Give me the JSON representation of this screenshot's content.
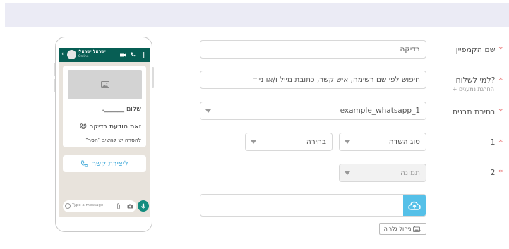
{
  "form": {
    "campaign_name": {
      "label": "שם הקמפיין",
      "value": "בדיקה"
    },
    "recipients": {
      "label": "למי לשלוח?",
      "sublabel": "+ החרגת נמענים",
      "placeholder": "חיפוש לפי שם רשימה, איש קשר, כתובת מייל ו/או נייד"
    },
    "template": {
      "label": "בחירת תבנית",
      "value": "example_whatsapp_1"
    },
    "variable_1": {
      "label": "1",
      "field_type": "סוג השדה",
      "choice": "בחירה"
    },
    "variable_2": {
      "label": "2",
      "field_type": "תמונה"
    },
    "gallery_button": "ניהול גלריה"
  },
  "preview": {
    "contact_name": "ישראל ישראלי",
    "contact_status": "Online",
    "greeting": "שלום ______,",
    "message_line": "זאת הודעת בדיקה",
    "message_emoji": "😆",
    "unsubscribe_line": "להסרה יש להשיב \"הסר\"",
    "cta_label": "ליצירת קשר",
    "input_placeholder": "Type a message"
  },
  "icons": {
    "upload": "cloud-upload-icon",
    "gallery": "gallery-icon",
    "image_placeholder": "image-icon",
    "phone_cta": "phone-icon"
  },
  "colors": {
    "required_star": "#e25858",
    "upload_button": "#55c0e8",
    "whatsapp_header": "#075e54",
    "whatsapp_chat_bg": "#e8e3dc",
    "cta_text": "#3da7d8"
  }
}
